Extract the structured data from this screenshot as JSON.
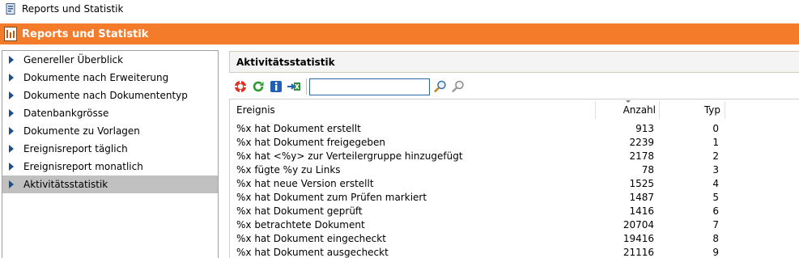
{
  "window": {
    "title": "Reports und Statistik"
  },
  "header": {
    "title": "Reports und Statistik"
  },
  "sidebar": {
    "items": [
      {
        "label": "Genereller Überblick"
      },
      {
        "label": "Dokumente nach Erweiterung"
      },
      {
        "label": "Dokumente nach Dokumententyp"
      },
      {
        "label": "Datenbankgrösse"
      },
      {
        "label": "Dokumente zu Vorlagen"
      },
      {
        "label": "Ereignisreport täglich"
      },
      {
        "label": "Ereignisreport monatlich"
      },
      {
        "label": "Aktivitätsstatistik",
        "active": true
      }
    ]
  },
  "panel": {
    "title": "Aktivitätsstatistik"
  },
  "toolbar": {
    "search_value": ""
  },
  "table": {
    "columns": [
      "Ereignis",
      "Anzahl",
      "Typ"
    ],
    "rows": [
      {
        "ereignis": "%x hat Dokument erstellt",
        "anzahl": "913",
        "typ": "0"
      },
      {
        "ereignis": "%x hat Dokument freigegeben",
        "anzahl": "2239",
        "typ": "1"
      },
      {
        "ereignis": "%x hat <%y> zur Verteilergruppe hinzugefügt",
        "anzahl": "2178",
        "typ": "2"
      },
      {
        "ereignis": "%x fügte %y zu Links",
        "anzahl": "78",
        "typ": "3"
      },
      {
        "ereignis": "%x hat neue Version erstellt",
        "anzahl": "1525",
        "typ": "4"
      },
      {
        "ereignis": "%x hat Dokument zum Prüfen markiert",
        "anzahl": "1487",
        "typ": "5"
      },
      {
        "ereignis": "%x hat Dokument geprüft",
        "anzahl": "1416",
        "typ": "6"
      },
      {
        "ereignis": "%x betrachtete Dokument",
        "anzahl": "20704",
        "typ": "7"
      },
      {
        "ereignis": "%x hat Dokument eingecheckt",
        "anzahl": "19416",
        "typ": "8"
      },
      {
        "ereignis": "%x hat Dokument ausgecheckt",
        "anzahl": "21116",
        "typ": "9"
      }
    ]
  },
  "colors": {
    "header_orange": "#f47b2a",
    "sidebar_active": "#c0c0c0",
    "tree_arrow": "#1a4f8a"
  }
}
